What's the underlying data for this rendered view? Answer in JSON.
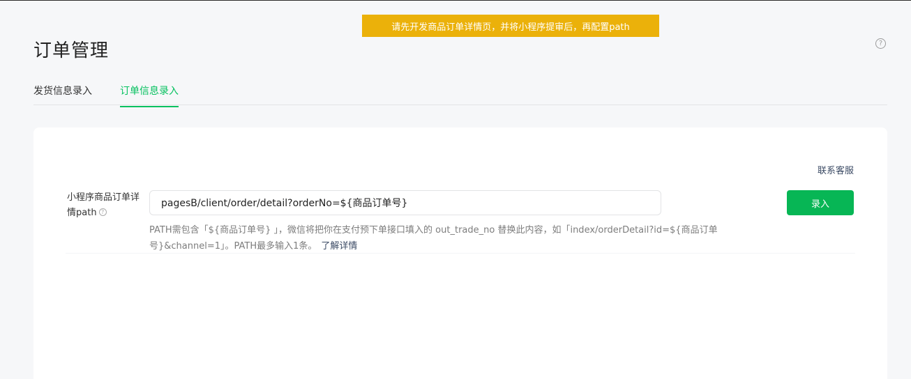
{
  "banner": {
    "text": "请先开发商品订单详情页，并将小程序提审后，再配置path"
  },
  "header": {
    "title": "订单管理",
    "help_icon": "?"
  },
  "tabs": [
    {
      "label": "发货信息录入",
      "active": false
    },
    {
      "label": "订单信息录入",
      "active": true
    }
  ],
  "card": {
    "contact_link": "联系客服",
    "form": {
      "label": "小程序商品订单详情path",
      "label_help_icon": "?",
      "input_value": "pagesB/client/order/detail?orderNo=${商品订单号}",
      "submit_label": "录入",
      "hint_text": "PATH需包含「${商品订单号} 」，微信将把你在支付预下单接口填入的 out_trade_no 替换此内容，如「index/orderDetail?id=${商品订单号}&channel=1」。PATH最多输入1条。",
      "hint_link": "了解详情"
    }
  },
  "colors": {
    "accent": "#07c160",
    "banner_bg": "#ebb10a",
    "link": "#3b4a64"
  }
}
